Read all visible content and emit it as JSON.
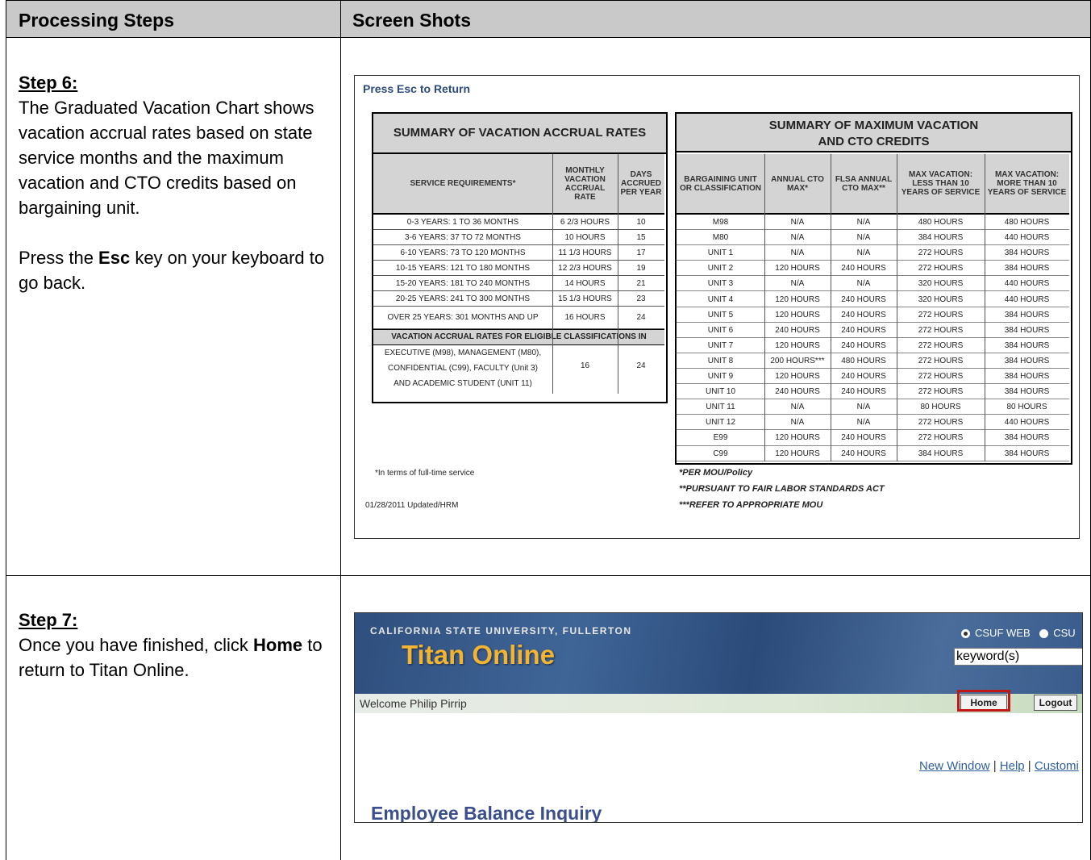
{
  "header": {
    "col1": "Processing Steps",
    "col2": "Screen Shots"
  },
  "step6": {
    "label": "Step 6:",
    "text": "The Graduated Vacation Chart shows vacation accrual rates based on state service months and the maximum vacation and CTO credits based on bargaining unit.",
    "press_pre": "Press the ",
    "press_key": "Esc",
    "press_post": " key on your keyboard to go back."
  },
  "step7": {
    "label": "Step 7:",
    "text_pre": "Once you have finished, click ",
    "text_key": "Home",
    "text_post": " to return to Titan Online."
  },
  "chart_screen": {
    "esc_link": "Press Esc to Return",
    "left_table": {
      "title": "SUMMARY OF VACATION ACCRUAL RATES",
      "headers": [
        "SERVICE REQUIREMENTS*",
        "MONTHLY VACATION ACCRUAL RATE",
        "DAYS ACCRUED PER YEAR"
      ],
      "rows": [
        [
          "0-3 YEARS: 1 TO 36 MONTHS",
          "6 2/3 HOURS",
          "10"
        ],
        [
          "3-6 YEARS: 37 TO 72 MONTHS",
          "10 HOURS",
          "15"
        ],
        [
          "6-10 YEARS: 73 TO 120 MONTHS",
          "11 1/3 HOURS",
          "17"
        ],
        [
          "10-15 YEARS: 121 TO 180 MONTHS",
          "12 2/3 HOURS",
          "19"
        ],
        [
          "15-20 YEARS: 181 TO 240 MONTHS",
          "14 HOURS",
          "21"
        ],
        [
          "20-25 YEARS: 241 TO 300 MONTHS",
          "15 1/3 HOURS",
          "23"
        ],
        [
          "OVER 25 YEARS: 301 MONTHS AND UP",
          "16 HOURS",
          "24"
        ]
      ],
      "eligible_header": "VACATION ACCRUAL RATES FOR ELIGIBLE CLASSIFICATIONS IN",
      "eligible_lines": [
        "EXECUTIVE (M98), MANAGEMENT (M80),",
        "CONFIDENTIAL (C99), FACULTY (Unit 3)",
        "AND ACADEMIC STUDENT (UNIT 11)"
      ],
      "eligible_rate": "16",
      "eligible_days": "24"
    },
    "right_table": {
      "title_line1": "SUMMARY OF MAXIMUM VACATION",
      "title_line2": "AND CTO CREDITS",
      "headers": [
        "BARGAINING UNIT OR CLASSIFICATION",
        "ANNUAL CTO MAX*",
        "FLSA ANNUAL CTO MAX**",
        "MAX VACATION: LESS THAN 10 YEARS OF SERVICE",
        "MAX VACATION: MORE THAN 10 YEARS OF SERVICE"
      ],
      "rows": [
        [
          "M98",
          "N/A",
          "N/A",
          "480 HOURS",
          "480 HOURS"
        ],
        [
          "M80",
          "N/A",
          "N/A",
          "384 HOURS",
          "440 HOURS"
        ],
        [
          "UNIT 1",
          "N/A",
          "N/A",
          "272 HOURS",
          "384 HOURS"
        ],
        [
          "UNIT 2",
          "120 HOURS",
          "240 HOURS",
          "272 HOURS",
          "384 HOURS"
        ],
        [
          "UNIT 3",
          "N/A",
          "N/A",
          "320 HOURS",
          "440 HOURS"
        ],
        [
          "UNIT 4",
          "120 HOURS",
          "240 HOURS",
          "320 HOURS",
          "440 HOURS"
        ],
        [
          "UNIT 5",
          "120 HOURS",
          "240 HOURS",
          "272 HOURS",
          "384 HOURS"
        ],
        [
          "UNIT 6",
          "240 HOURS",
          "240 HOURS",
          "272 HOURS",
          "384 HOURS"
        ],
        [
          "UNIT 7",
          "120 HOURS",
          "240 HOURS",
          "272 HOURS",
          "384 HOURS"
        ],
        [
          "UNIT 8",
          "200 HOURS***",
          "480 HOURS",
          "272 HOURS",
          "384 HOURS"
        ],
        [
          "UNIT 9",
          "120 HOURS",
          "240 HOURS",
          "272 HOURS",
          "384 HOURS"
        ],
        [
          "UNIT 10",
          "240 HOURS",
          "240 HOURS",
          "272 HOURS",
          "384 HOURS"
        ],
        [
          "UNIT 11",
          "N/A",
          "N/A",
          "80 HOURS",
          "80 HOURS"
        ],
        [
          "UNIT 12",
          "N/A",
          "N/A",
          "272 HOURS",
          "440 HOURS"
        ],
        [
          "E99",
          "120 HOURS",
          "240 HOURS",
          "272 HOURS",
          "384 HOURS"
        ],
        [
          "C99",
          "120 HOURS",
          "240 HOURS",
          "384 HOURS",
          "384 HOURS"
        ]
      ]
    },
    "footnote_left1": "*In terms of full-time service",
    "footnote_left2": "01/28/2011 Updated/HRM",
    "footnote_right1": "*PER MOU/Policy",
    "footnote_right2": "**PURSUANT TO FAIR LABOR STANDARDS ACT",
    "footnote_right3": "***REFER TO APPROPRIATE MOU"
  },
  "titan_screen": {
    "university": "CALIFORNIA STATE UNIVERSITY, FULLERTON",
    "app_name": "Titan Online",
    "radio1": "CSUF WEB",
    "radio2": "CSU",
    "search_value": "keyword(s)",
    "welcome": "Welcome Philip Pirrip",
    "home_button": "Home",
    "logout_button": "Logout",
    "link_new_window": "New Window",
    "link_help": "Help",
    "link_customize": "Customi",
    "page_title": "Employee Balance Inquiry",
    "highlight_color": "#c01818"
  }
}
